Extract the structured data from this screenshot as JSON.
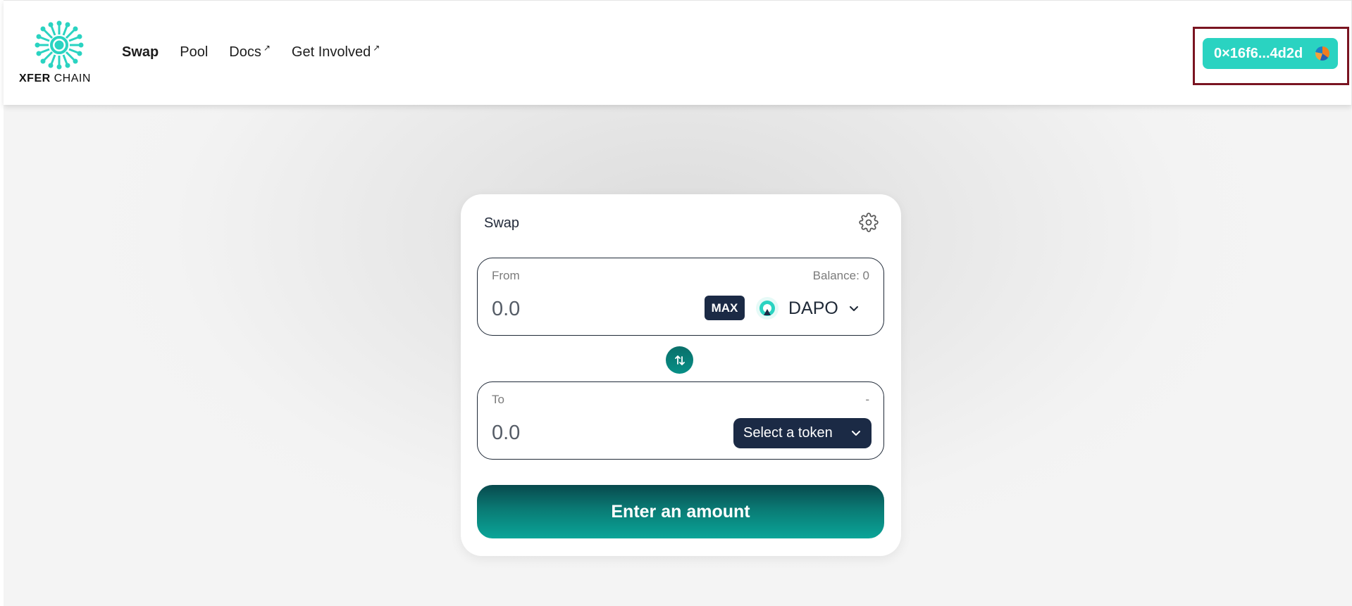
{
  "brand": {
    "name_bold": "XFER",
    "name_regular": "CHAIN",
    "accent_color": "#2ad3c1",
    "dark_color": "#1b2a45"
  },
  "nav": {
    "items": [
      {
        "label": "Swap",
        "external": false,
        "active": true
      },
      {
        "label": "Pool",
        "external": false,
        "active": false
      },
      {
        "label": "Docs",
        "external": true,
        "active": false
      },
      {
        "label": "Get Involved",
        "external": true,
        "active": false
      }
    ],
    "external_glyph": "↗"
  },
  "wallet": {
    "address": "0×16f6...4d2d",
    "avatar_icon": "wallet-avatar-icon"
  },
  "swap": {
    "title": "Swap",
    "settings_icon": "gear-icon",
    "from": {
      "label": "From",
      "balance_label": "Balance: 0",
      "amount_placeholder": "0.0",
      "max_label": "MAX",
      "token": "DAPO"
    },
    "direction_icon": "swap-arrows-icon",
    "to": {
      "label": "To",
      "right_label": "-",
      "amount_placeholder": "0.0",
      "select_label": "Select a token"
    },
    "submit_label": "Enter an amount"
  }
}
